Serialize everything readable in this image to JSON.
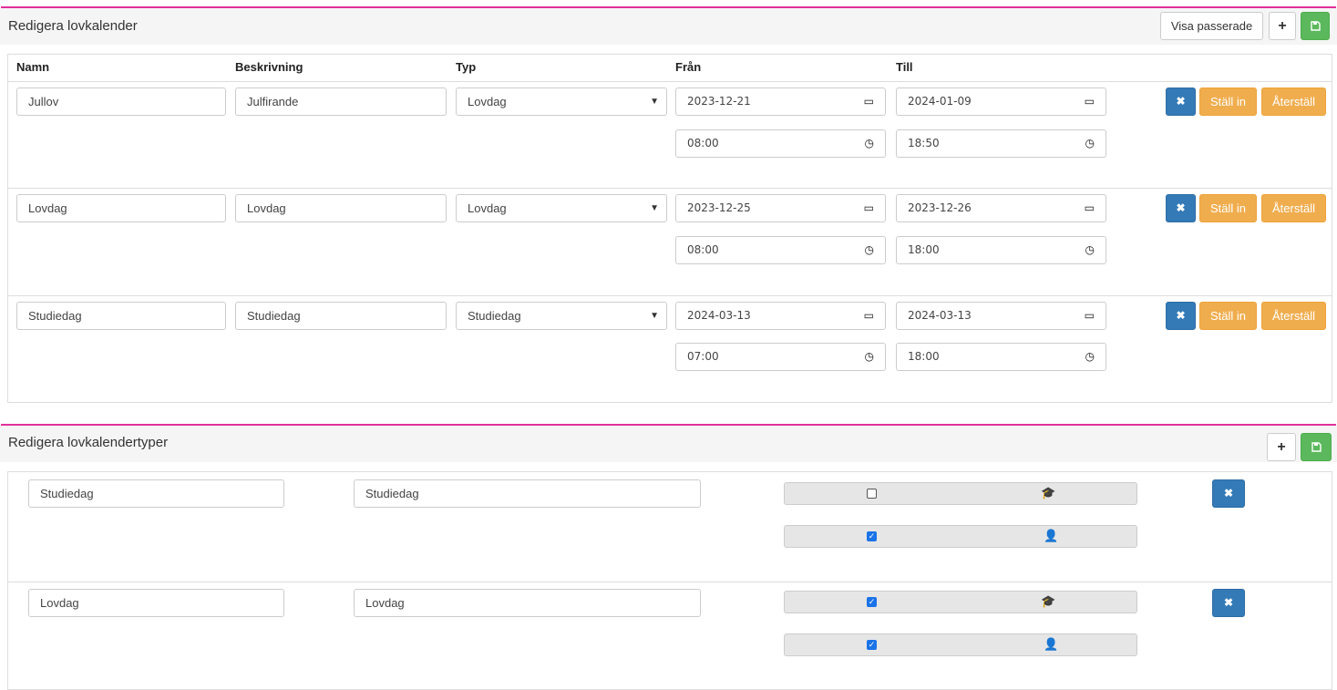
{
  "calendar": {
    "title": "Redigera lovkalender",
    "show_past_label": "Visa passerade",
    "add_icon": "plus-icon",
    "save_icon": "save-icon",
    "columns": {
      "name": "Namn",
      "description": "Beskrivning",
      "type": "Typ",
      "from": "Från",
      "to": "Till"
    },
    "rows": [
      {
        "name": "Jullov",
        "description": "Julfirande",
        "type": "Lovdag",
        "from_date": "2023-12-21",
        "to_date": "2024-01-09",
        "from_time": "08:00",
        "to_time": "18:50"
      },
      {
        "name": "Lovdag",
        "description": "Lovdag",
        "type": "Lovdag",
        "from_date": "2023-12-25",
        "to_date": "2023-12-26",
        "from_time": "08:00",
        "to_time": "18:00"
      },
      {
        "name": "Studiedag",
        "description": "Studiedag",
        "type": "Studiedag",
        "from_date": "2024-03-13",
        "to_date": "2024-03-13",
        "from_time": "07:00",
        "to_time": "18:00"
      }
    ],
    "row_buttons": {
      "delete_icon": "times-icon",
      "cancel_label": "Ställ in",
      "reset_label": "Återställ"
    }
  },
  "types": {
    "title": "Redigera lovkalendertyper",
    "rows": [
      {
        "name": "Studiedag",
        "description": "Studiedag",
        "student_checked": false,
        "staff_checked": true
      },
      {
        "name": "Lovdag",
        "description": "Lovdag",
        "student_checked": true,
        "staff_checked": true
      }
    ]
  },
  "colors": {
    "accent": "#e0309c",
    "primary": "#337ab7",
    "warning": "#f0ad4e",
    "success": "#5cb85c"
  }
}
